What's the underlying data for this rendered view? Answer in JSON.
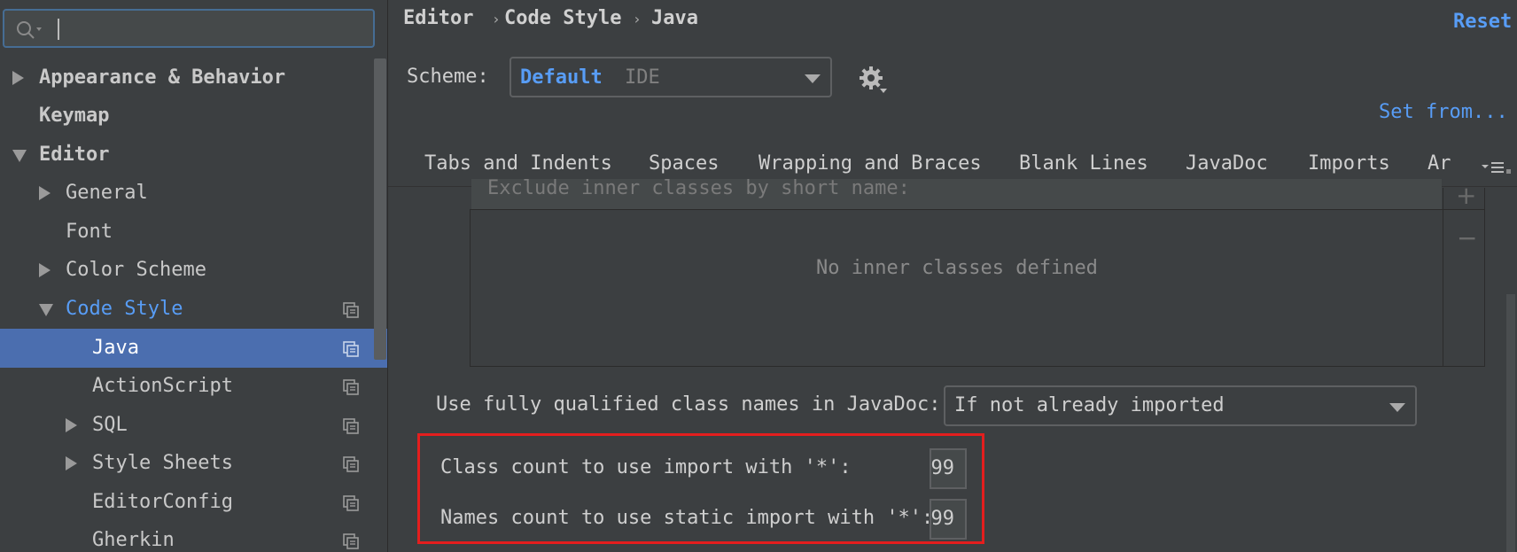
{
  "sidebar": {
    "search": {
      "value": "",
      "placeholder": ""
    },
    "items": [
      {
        "label": "Appearance & Behavior"
      },
      {
        "label": "Keymap"
      },
      {
        "label": "Editor"
      },
      {
        "label": "General"
      },
      {
        "label": "Font"
      },
      {
        "label": "Color Scheme"
      },
      {
        "label": "Code Style"
      },
      {
        "label": "Java"
      },
      {
        "label": "ActionScript"
      },
      {
        "label": "SQL"
      },
      {
        "label": "Style Sheets"
      },
      {
        "label": "EditorConfig"
      },
      {
        "label": "Gherkin"
      }
    ],
    "selected": "Java"
  },
  "breadcrumb": [
    "Editor",
    "Code Style",
    "Java"
  ],
  "reset_label": "Reset",
  "scheme": {
    "label": "Scheme:",
    "name": "Default",
    "type": "IDE"
  },
  "set_from_label": "Set from...",
  "tabs": [
    {
      "label": "Tabs and Indents"
    },
    {
      "label": "Spaces"
    },
    {
      "label": "Wrapping and Braces"
    },
    {
      "label": "Blank Lines"
    },
    {
      "label": "JavaDoc"
    },
    {
      "label": "Imports"
    },
    {
      "label": "Ar"
    }
  ],
  "active_tab": "Imports",
  "inner_classes": {
    "header": "Exclude inner classes by short name:",
    "empty_message": "No inner classes defined",
    "add_label": "+",
    "remove_label": "−"
  },
  "javadoc_fq": {
    "label": "Use fully qualified class names in JavaDoc:",
    "value": "If not already imported"
  },
  "class_count": {
    "label": "Class count to use import with '*':",
    "value": "99"
  },
  "names_count": {
    "label": "Names count to use static import with '*':",
    "value": "99"
  },
  "colors": {
    "accent": "#589df6",
    "selection": "#4b6eaf",
    "highlight": "#e41e1e",
    "background": "#3c3f41"
  }
}
